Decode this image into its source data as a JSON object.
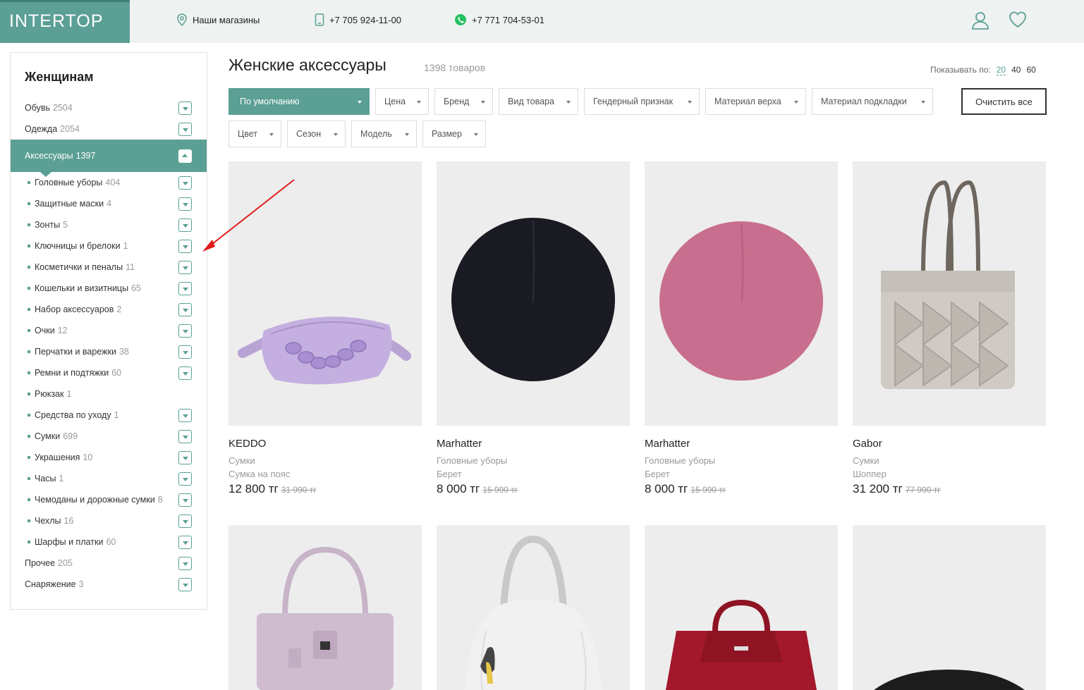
{
  "header": {
    "logo": "INTERTOP",
    "stores": "Наши магазины",
    "phone": "+7 705 924-11-00",
    "whatsapp": "+7 771 704-53-01"
  },
  "sidebar": {
    "title": "Женщинам",
    "top_items": [
      {
        "label": "Обувь",
        "count": "2504"
      },
      {
        "label": "Одежда",
        "count": "2054"
      }
    ],
    "active": {
      "label": "Аксессуары",
      "count": "1397"
    },
    "sub_items": [
      {
        "label": "Головные уборы",
        "count": "404"
      },
      {
        "label": "Защитные маски",
        "count": "4"
      },
      {
        "label": "Зонты",
        "count": "5"
      },
      {
        "label": "Ключницы и брелоки",
        "count": "1"
      },
      {
        "label": "Косметички и пеналы",
        "count": "11"
      },
      {
        "label": "Кошельки и визитницы",
        "count": "65"
      },
      {
        "label": "Набор аксессуаров",
        "count": "2"
      },
      {
        "label": "Очки",
        "count": "12"
      },
      {
        "label": "Перчатки и варежки",
        "count": "38"
      },
      {
        "label": "Ремни и подтяжки",
        "count": "60"
      },
      {
        "label": "Рюкзак",
        "count": "1"
      },
      {
        "label": "Средства по уходу",
        "count": "1"
      },
      {
        "label": "Сумки",
        "count": "699"
      },
      {
        "label": "Украшения",
        "count": "10"
      },
      {
        "label": "Часы",
        "count": "1"
      },
      {
        "label": "Чемоданы и дорожные сумки",
        "count": "8"
      },
      {
        "label": "Чехлы",
        "count": "16"
      },
      {
        "label": "Шарфы и платки",
        "count": "60"
      }
    ],
    "bottom_items": [
      {
        "label": "Прочее",
        "count": "205"
      },
      {
        "label": "Снаряжение",
        "count": "3"
      }
    ]
  },
  "main": {
    "title": "Женские аксессуары",
    "total": "1398 товаров",
    "perpage_label": "Показывать по:",
    "perpage_options": [
      "20",
      "40",
      "60"
    ],
    "sort": "По умолчанию",
    "filters": [
      "Цена",
      "Бренд",
      "Вид товара",
      "Гендерный признак",
      "Материал верха",
      "Материал подкладки",
      "Цвет",
      "Сезон",
      "Модель",
      "Размер"
    ],
    "clear_all": "Очистить все",
    "products": [
      {
        "brand": "KEDDO",
        "category": "Сумки",
        "type": "Сумка на пояс",
        "price": "12 800 тг",
        "old_price": "31 990 тг"
      },
      {
        "brand": "Marhatter",
        "category": "Головные уборы",
        "type": "Берет",
        "price": "8 000 тг",
        "old_price": "15 990 тг"
      },
      {
        "brand": "Marhatter",
        "category": "Головные уборы",
        "type": "Берет",
        "price": "8 000 тг",
        "old_price": "15 990 тг"
      },
      {
        "brand": "Gabor",
        "category": "Сумки",
        "type": "Шоппер",
        "price": "31 200 тг",
        "old_price": "77 990 тг"
      }
    ]
  },
  "colors": {
    "accent": "#5b9f95",
    "arrow": "#e01b1b"
  }
}
